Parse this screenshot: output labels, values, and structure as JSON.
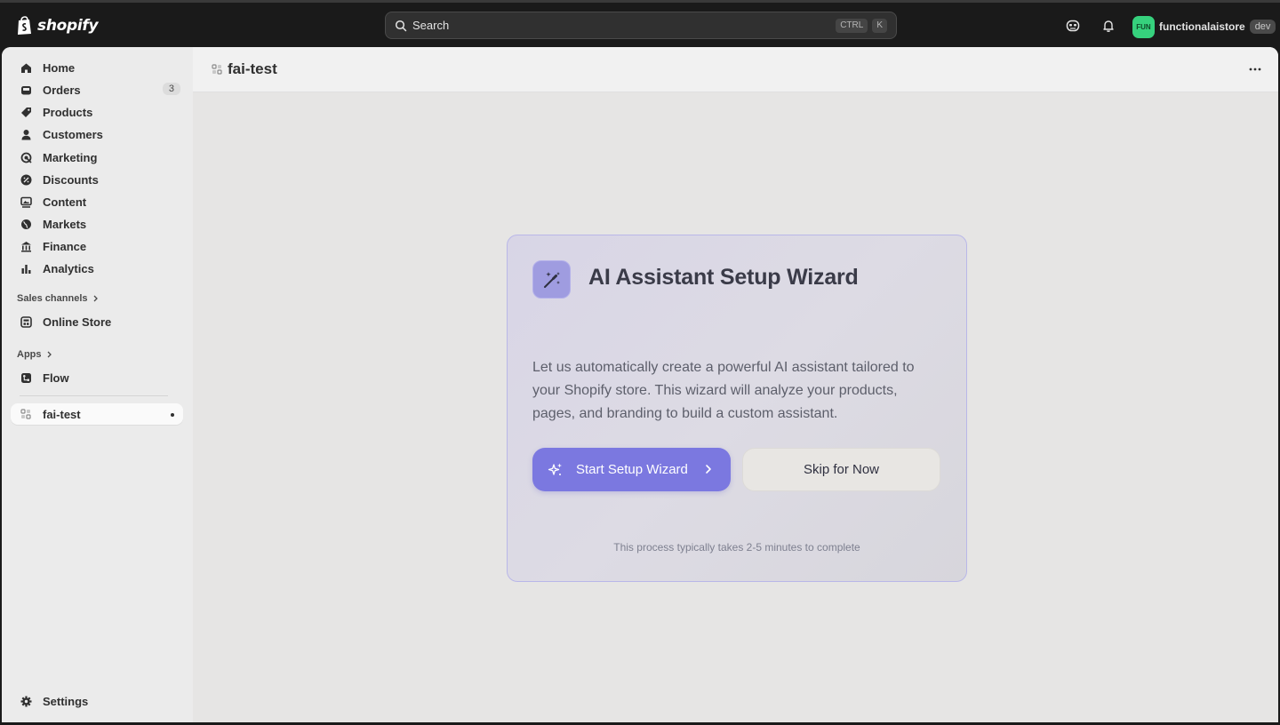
{
  "topbar": {
    "logo_text": "shopify",
    "search_placeholder": "Search",
    "shortcut_ctrl": "CTRL",
    "shortcut_k": "K",
    "user": {
      "avatar_initials": "FUN",
      "store_name": "functionalaistore",
      "badge": "dev",
      "avatar_color": "#36d17d"
    },
    "icons": [
      "sidekick-icon",
      "bell-icon"
    ]
  },
  "sidebar": {
    "items": [
      {
        "label": "Home",
        "icon": "home-icon"
      },
      {
        "label": "Orders",
        "icon": "inbox-icon",
        "badge": "3"
      },
      {
        "label": "Products",
        "icon": "tag-icon"
      },
      {
        "label": "Customers",
        "icon": "person-icon"
      },
      {
        "label": "Marketing",
        "icon": "target-icon"
      },
      {
        "label": "Discounts",
        "icon": "discount-icon"
      },
      {
        "label": "Content",
        "icon": "image-icon"
      },
      {
        "label": "Markets",
        "icon": "globe-icon"
      },
      {
        "label": "Finance",
        "icon": "bank-icon"
      },
      {
        "label": "Analytics",
        "icon": "bar-chart-icon"
      }
    ],
    "sales_channels_title": "Sales channels",
    "sales_channels": [
      {
        "label": "Online Store",
        "icon": "store-icon"
      }
    ],
    "apps_title": "Apps",
    "apps": [
      {
        "label": "Flow",
        "icon": "flow-icon"
      }
    ],
    "active_app": {
      "label": "fai-test",
      "icon": "app-icon"
    },
    "settings": {
      "label": "Settings",
      "icon": "gear-icon"
    }
  },
  "page": {
    "title": "fai-test"
  },
  "wizard": {
    "title": "AI Assistant Setup Wizard",
    "description": "Let us automatically create a powerful AI assistant tailored to your Shopify store. This wizard will analyze your products, pages, and branding to build a custom assistant.",
    "primary_button": "Start Setup Wizard",
    "secondary_button": "Skip for Now",
    "note": "This process typically takes 2-5 minutes to complete",
    "accent_color": "#7b78e0"
  }
}
